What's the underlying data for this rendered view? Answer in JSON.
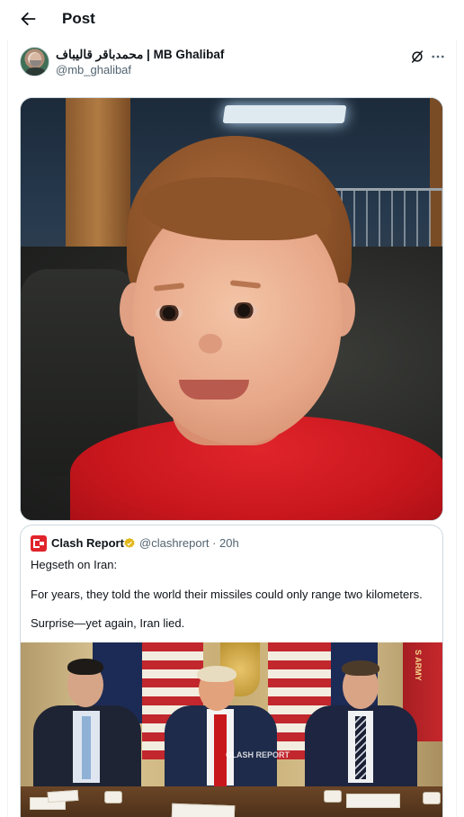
{
  "header": {
    "title": "Post",
    "back_icon": "arrow-left-icon"
  },
  "author": {
    "display_name": "محمدباقر قالیباف | MB Ghalibaf",
    "handle": "@mb_ghalibaf",
    "grok_icon": "grok-icon",
    "more_icon": "more-options-icon"
  },
  "quote": {
    "name": "Clash Report",
    "handle_time": "@clashreport · 20h",
    "verified_color": "#e2b719",
    "lines": [
      "Hegseth on Iran:",
      "For years, they told the world their missiles could only range two kilometers.",
      "Surprise—yet again, Iran lied."
    ],
    "watermark": "CLASH REPORT",
    "flag_text": "S ARMY"
  },
  "colors": {
    "text": "#0f1419",
    "secondary": "#536471",
    "border": "#cfd9de",
    "brand_red": "#e0242b"
  }
}
